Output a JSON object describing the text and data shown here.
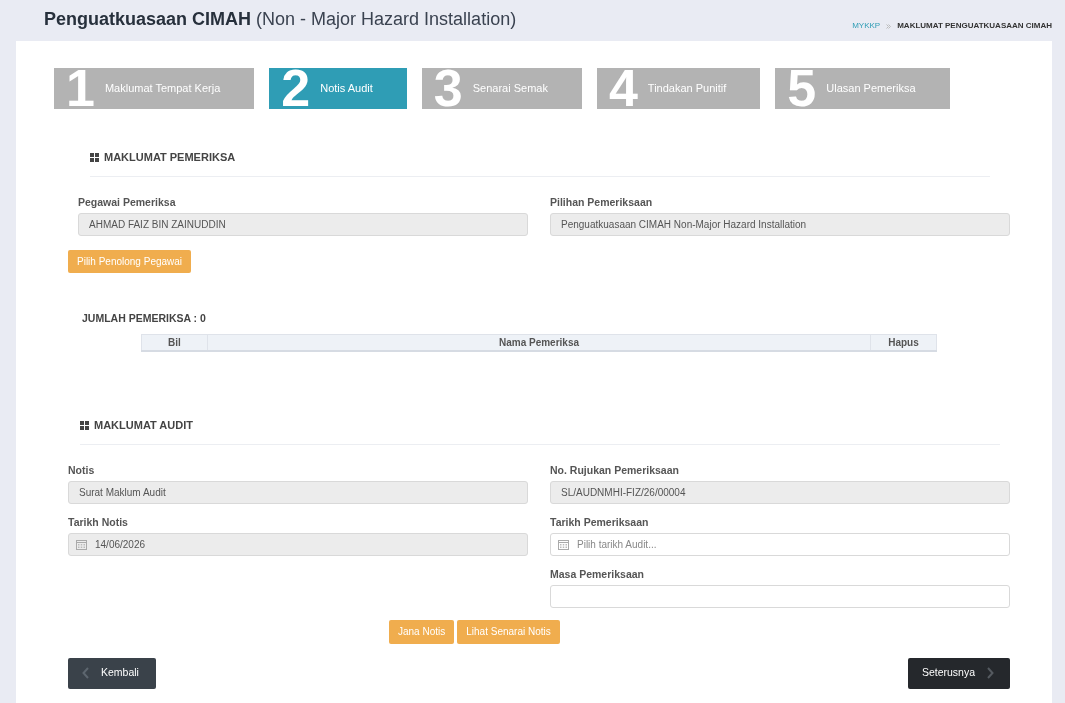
{
  "page_header": {
    "title": "Penguatkuasaan CIMAH",
    "subtitle": "(Non - Major Hazard Installation)"
  },
  "breadcrumb": [
    {
      "label": "MYKKP",
      "kind": "link"
    },
    {
      "label": "MAKLUMAT PENGUATKUASAAN CIMAH",
      "kind": "current"
    }
  ],
  "steps": [
    {
      "number": "1",
      "label": "Maklumat Tempat Kerja",
      "selected": false
    },
    {
      "number": "2",
      "label": "Notis Audit",
      "selected": true
    },
    {
      "number": "3",
      "label": "Senarai Semak",
      "selected": false
    },
    {
      "number": "4",
      "label": "Tindakan Punitif",
      "selected": false
    },
    {
      "number": "5",
      "label": "Ulasan Pemeriksa",
      "selected": false
    }
  ],
  "inspector_section": {
    "heading": "MAKLUMAT PEMERIKSA",
    "fields": [
      {
        "label": "Pegawai Pemeriksa",
        "kind": "text",
        "readonly": true,
        "value": "AHMAD FAIZ BIN ZAINUDDIN"
      },
      {
        "label": "Pilihan Pemeriksaan",
        "kind": "text",
        "readonly": true,
        "value": "Penguatkuasaan CIMAH Non-Major Hazard Installation"
      }
    ],
    "button": "Pilih Penolong Pegawai",
    "count_label": "JUMLAH PEMERIKSA : 0",
    "table": {
      "columns": [
        "Bil",
        "Nama Pemeriksa",
        "Hapus"
      ]
    }
  },
  "audit_section": {
    "heading": "MAKLUMAT AUDIT",
    "left_fields": [
      {
        "label": "Notis",
        "kind": "text",
        "readonly": true,
        "value": "Surat Maklum Audit"
      },
      {
        "label": "Tarikh Notis",
        "kind": "date",
        "readonly": true,
        "value": "14/06/2026"
      }
    ],
    "right_fields": [
      {
        "label": "No. Rujukan Pemeriksaan",
        "kind": "text",
        "readonly": true,
        "value": "SL/AUDNMHI-FIZ/26/00004"
      },
      {
        "label": "Tarikh Pemeriksaan",
        "kind": "date",
        "readonly": false,
        "placeholder": "Pilih tarikh Audit..."
      },
      {
        "label": "Masa Pemeriksaan",
        "kind": "text",
        "readonly": false
      }
    ],
    "buttons": [
      "Jana Notis",
      "Lihat Senarai Notis"
    ]
  },
  "footer_buttons": [
    {
      "label": "Kembali",
      "kind": "back"
    },
    {
      "label": "Seterusnya",
      "kind": "next"
    }
  ]
}
